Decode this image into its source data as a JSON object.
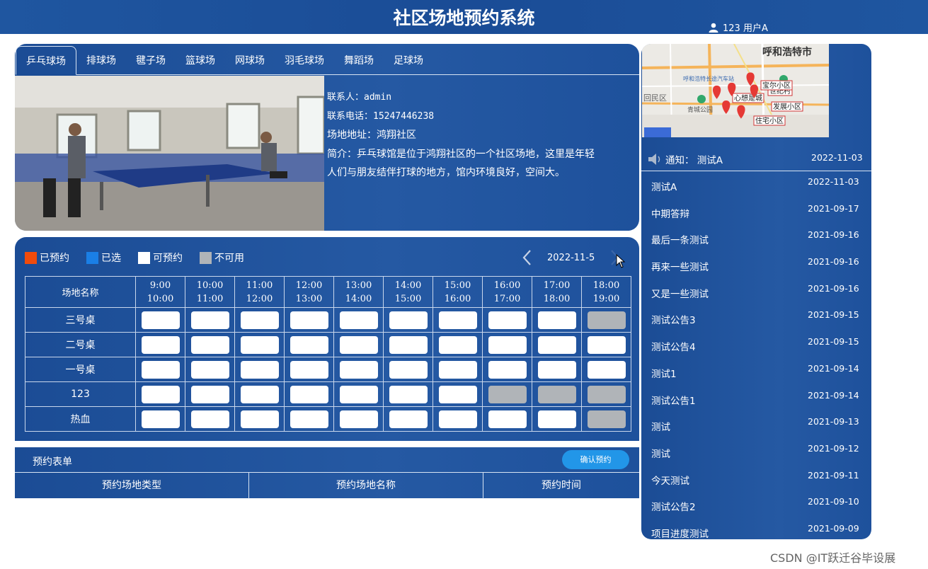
{
  "header": {
    "title": "社区场地预约系统",
    "user": "123 用户A"
  },
  "tabs": [
    "乒乓球场",
    "排球场",
    "毽子场",
    "篮球场",
    "网球场",
    "羽毛球场",
    "舞蹈场",
    "足球场"
  ],
  "active_tab": 0,
  "venue": {
    "contact": "联系人：admin",
    "phone": "联系电话：15247446238",
    "address": "场地地址：鸿翔社区",
    "intro": "简介：乒乓球馆是位于鸿翔社区的一个社区场地，这里是年轻人们与朋友结伴打球的地方，馆内环境良好，空间大。"
  },
  "legend": [
    {
      "label": "已预约",
      "color": "#f04b0c"
    },
    {
      "label": "已选",
      "color": "#1a7fe6"
    },
    {
      "label": "可预约",
      "color": "#ffffff"
    },
    {
      "label": "不可用",
      "color": "#b0b4b8"
    }
  ],
  "date": "2022-11-5",
  "schedule": {
    "name_header": "场地名称",
    "slots": [
      {
        "start": "9:00",
        "end": "10:00"
      },
      {
        "start": "10:00",
        "end": "11:00"
      },
      {
        "start": "11:00",
        "end": "12:00"
      },
      {
        "start": "12:00",
        "end": "13:00"
      },
      {
        "start": "13:00",
        "end": "14:00"
      },
      {
        "start": "14:00",
        "end": "15:00"
      },
      {
        "start": "15:00",
        "end": "16:00"
      },
      {
        "start": "16:00",
        "end": "17:00"
      },
      {
        "start": "17:00",
        "end": "18:00"
      },
      {
        "start": "18:00",
        "end": "19:00"
      }
    ],
    "rows": [
      {
        "name": "三号桌",
        "status": [
          "A",
          "A",
          "A",
          "A",
          "A",
          "A",
          "A",
          "A",
          "A",
          "U"
        ]
      },
      {
        "name": "二号桌",
        "status": [
          "A",
          "A",
          "A",
          "A",
          "A",
          "A",
          "A",
          "A",
          "A",
          "A"
        ]
      },
      {
        "name": "一号桌",
        "status": [
          "A",
          "A",
          "A",
          "A",
          "A",
          "A",
          "A",
          "A",
          "A",
          "A"
        ]
      },
      {
        "name": "123",
        "status": [
          "A",
          "A",
          "A",
          "A",
          "A",
          "A",
          "A",
          "U",
          "U",
          "U"
        ]
      },
      {
        "name": "热血",
        "status": [
          "A",
          "A",
          "A",
          "A",
          "A",
          "A",
          "A",
          "A",
          "A",
          "U"
        ]
      }
    ]
  },
  "form": {
    "title": "预约表单",
    "confirm": "确认预约",
    "columns": [
      "预约场地类型",
      "预约场地名称",
      "预约时间"
    ]
  },
  "map": {
    "city_label": "呼和浩特市",
    "station_label": "呼和浩特长途汽车站",
    "district_label": "回民区",
    "park_label": "青城公园",
    "places": [
      "心想是城",
      "发展小区",
      "住宅小区",
      "世纪村",
      "宝尔小区"
    ],
    "pins": [
      [
        0.4,
        0.59
      ],
      [
        0.48,
        0.56
      ],
      [
        0.58,
        0.45
      ],
      [
        0.6,
        0.58
      ],
      [
        0.45,
        0.75
      ],
      [
        0.53,
        0.8
      ]
    ]
  },
  "notice_head": {
    "label": "通知：  测试A",
    "date": "2022-11-03"
  },
  "notices": [
    {
      "title": "测试A",
      "date": "2022-11-03"
    },
    {
      "title": "中期答辩",
      "date": "2021-09-17"
    },
    {
      "title": "最后一条测试",
      "date": "2021-09-16"
    },
    {
      "title": "再来一些测试",
      "date": "2021-09-16"
    },
    {
      "title": "又是一些测试",
      "date": "2021-09-16"
    },
    {
      "title": "测试公告3",
      "date": "2021-09-15"
    },
    {
      "title": "测试公告4",
      "date": "2021-09-15"
    },
    {
      "title": "测试1",
      "date": "2021-09-14"
    },
    {
      "title": "测试公告1",
      "date": "2021-09-14"
    },
    {
      "title": "测试",
      "date": "2021-09-13"
    },
    {
      "title": "测试",
      "date": "2021-09-12"
    },
    {
      "title": "今天测试",
      "date": "2021-09-11"
    },
    {
      "title": "测试公告2",
      "date": "2021-09-10"
    },
    {
      "title": "项目进度测试",
      "date": "2021-09-09"
    }
  ],
  "watermark": "CSDN @IT跃迁谷毕设展"
}
